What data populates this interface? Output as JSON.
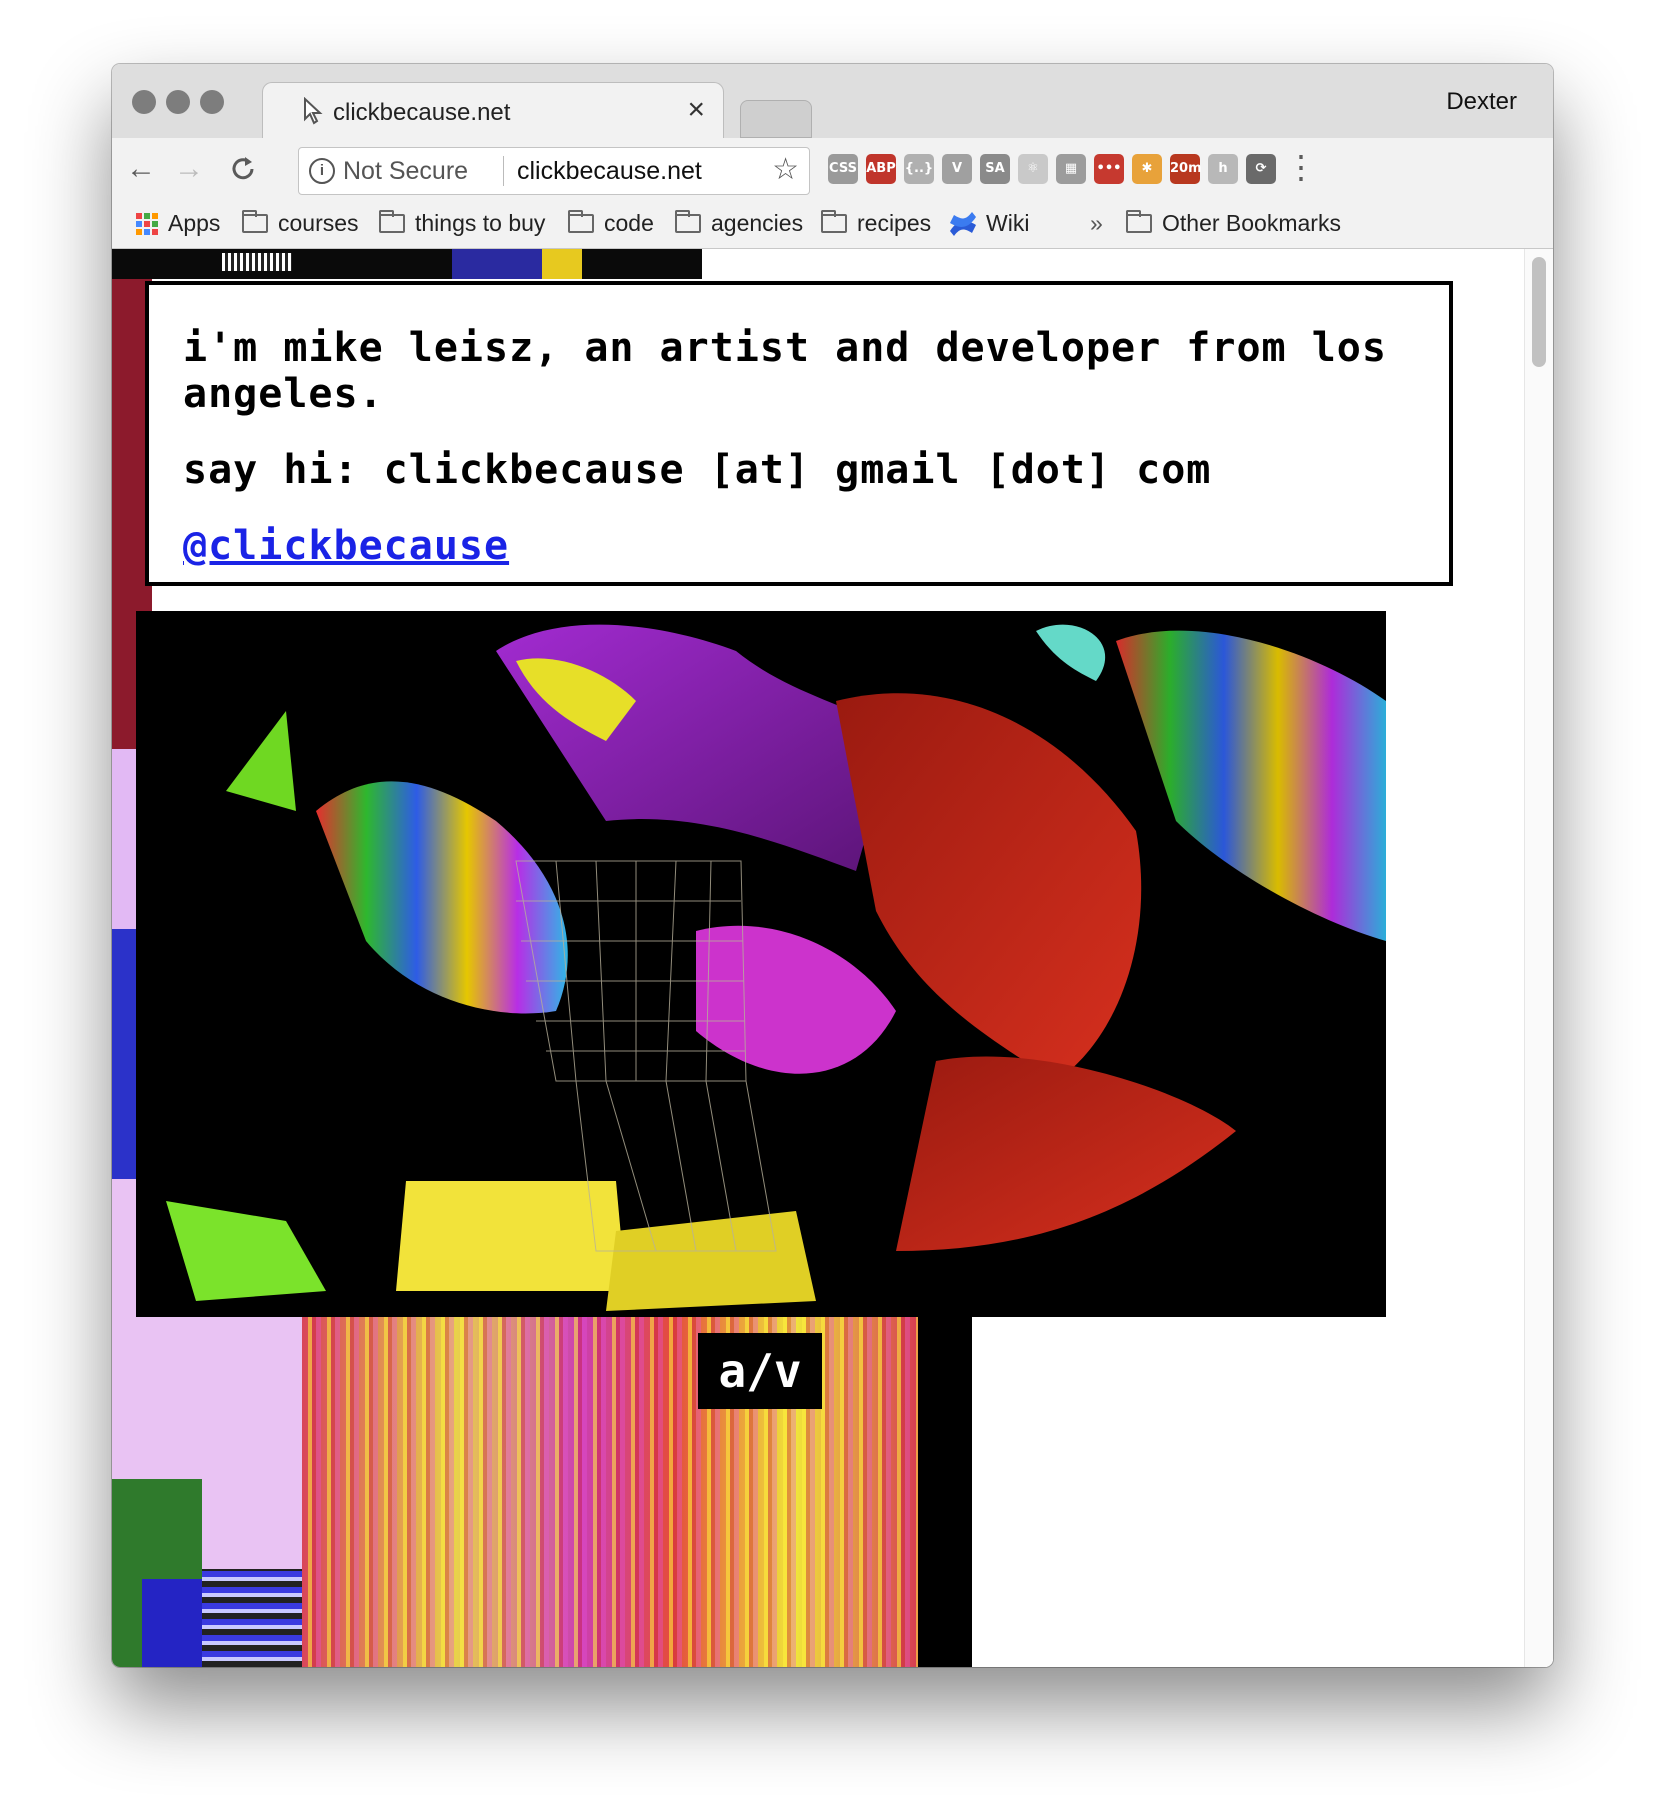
{
  "window": {
    "tab_title": "clickbecause.net",
    "tab_close": "×",
    "profile_name": "Dexter"
  },
  "toolbar": {
    "back": "←",
    "forward": "→",
    "reload": "C",
    "security_label": "Not Secure",
    "url": "clickbecause.net",
    "star": "☆",
    "menu": "⋮",
    "extensions": [
      {
        "name": "css-viewer-icon",
        "label": "CSS",
        "color": "#9a9a9a"
      },
      {
        "name": "adblock-plus-icon",
        "label": "ABP",
        "color": "#c0352b"
      },
      {
        "name": "json-formatter-icon",
        "label": "{..}",
        "color": "#b0b0b0"
      },
      {
        "name": "vue-devtools-icon",
        "label": "V",
        "color": "#a0a0a0"
      },
      {
        "name": "sa-extension-icon",
        "label": "SA",
        "color": "#8a8a8a"
      },
      {
        "name": "react-devtools-icon",
        "label": "⚛",
        "color": "#c9c9c9"
      },
      {
        "name": "page-ruler-icon",
        "label": "▦",
        "color": "#9c9c9c"
      },
      {
        "name": "lastpass-icon",
        "label": "•••",
        "color": "#c6392f"
      },
      {
        "name": "pinwheel-icon",
        "label": "✱",
        "color": "#e8a23a"
      },
      {
        "name": "timer-icon",
        "label": "20m",
        "color": "#b8381f"
      },
      {
        "name": "hypothesis-icon",
        "label": "h",
        "color": "#b8b8b8"
      },
      {
        "name": "sync-icon",
        "label": "⟳",
        "color": "#6a6a6a"
      }
    ]
  },
  "bookmarks": {
    "apps": "Apps",
    "items": [
      "courses",
      "things to buy",
      "code",
      "agencies",
      "recipes"
    ],
    "wiki": "Wiki",
    "overflow": "»",
    "other": "Other Bookmarks"
  },
  "page": {
    "intro_line1": "i'm mike leisz, an artist and developer from los angeles.",
    "intro_line2": "say hi: clickbecause [at] gmail [dot] com",
    "twitter_handle": "@clickbecause",
    "av_label": "a/v"
  },
  "colors": {
    "link": "#1a23e6",
    "window_chrome": "#dedede",
    "toolbar": "#f2f2f2"
  }
}
